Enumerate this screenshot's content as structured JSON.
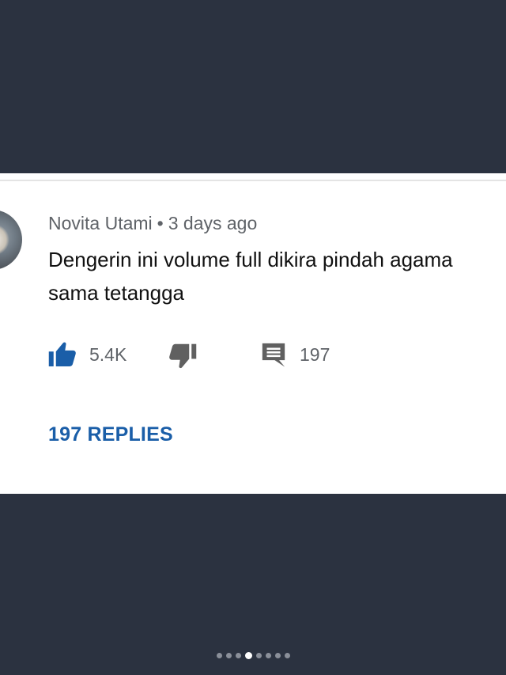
{
  "comment": {
    "author": "Novita Utami",
    "separator": "•",
    "time": "3 days ago",
    "text_lines": [
      "Dengerin ini volume full dikira pindah agama",
      "sama tetangga"
    ],
    "likes": "5.4K",
    "reply_count": "197",
    "replies_link": "197 REPLIES"
  },
  "carousel": {
    "total": 8,
    "active_index": 3
  },
  "colors": {
    "background": "#2b3240",
    "card": "#ffffff",
    "like_icon": "#1a5ea8",
    "replies_link": "#1a5ea8",
    "icon_gray": "#606060"
  },
  "icons": {
    "like": "thumbs-up-icon",
    "dislike": "thumbs-down-icon",
    "reply": "comment-icon"
  }
}
